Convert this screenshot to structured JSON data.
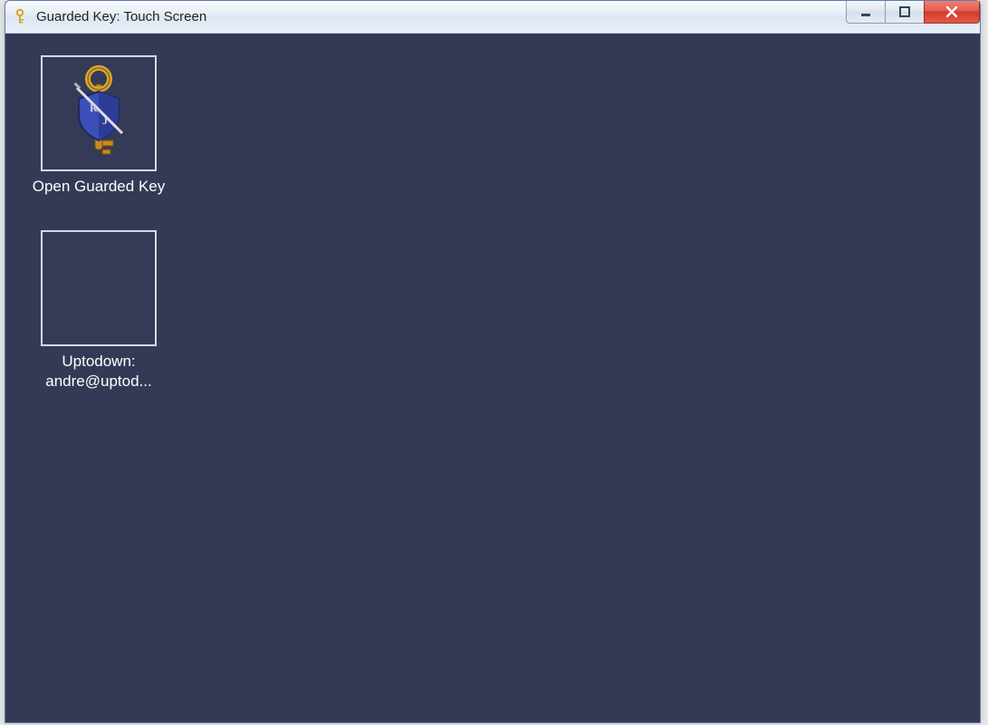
{
  "window": {
    "title": "Guarded Key: Touch Screen"
  },
  "tiles": [
    {
      "label": "Open Guarded Key",
      "icon": "guarded-key"
    },
    {
      "label": "Uptodown: andre@uptod...",
      "icon": ""
    }
  ]
}
